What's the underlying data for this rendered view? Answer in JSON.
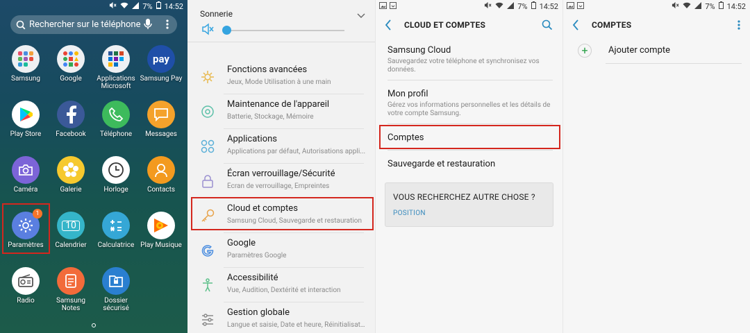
{
  "status_bar": {
    "battery": "7%",
    "time": "14:52"
  },
  "panel1": {
    "search_placeholder": "Rechercher sur le téléphone",
    "apps": [
      {
        "label": "Samsung"
      },
      {
        "label": "Google"
      },
      {
        "label": "Applications Microsoft"
      },
      {
        "label": "Samsung Pay",
        "icon_text": "pay"
      },
      {
        "label": "Play Store"
      },
      {
        "label": "Facebook"
      },
      {
        "label": "Téléphone"
      },
      {
        "label": "Messages"
      },
      {
        "label": "Caméra"
      },
      {
        "label": "Galerie"
      },
      {
        "label": "Horloge"
      },
      {
        "label": "Contacts"
      },
      {
        "label": "Paramètres",
        "badge": "1"
      },
      {
        "label": "Calendrier",
        "icon_text": "10"
      },
      {
        "label": "Calculatrice"
      },
      {
        "label": "Play Musique"
      },
      {
        "label": "Radio"
      },
      {
        "label": "Samsung Notes"
      },
      {
        "label": "Dossier sécurisé"
      }
    ]
  },
  "panel2": {
    "sound_label": "Sonnerie",
    "items": [
      {
        "title": "Fonctions avancées",
        "subtitle": "Jeux, Mode Utilisation à une main"
      },
      {
        "title": "Maintenance de l'appareil",
        "subtitle": "Batterie, Stockage, Mémoire"
      },
      {
        "title": "Applications",
        "subtitle": "Applications par défaut, Autorisations appli..."
      },
      {
        "title": "Écran verrouillage/Sécurité",
        "subtitle": "Écran de verrouillage, Empreintes"
      },
      {
        "title": "Cloud et comptes",
        "subtitle": "Samsung Cloud, Sauvegarde et restauration"
      },
      {
        "title": "Google",
        "subtitle": "Paramètres Google"
      },
      {
        "title": "Accessibilité",
        "subtitle": "Vue, Audition, Dextérité et interaction"
      },
      {
        "title": "Gestion globale",
        "subtitle": "Langue et saisie, Date et heure, Réinitialisati..."
      }
    ]
  },
  "panel3": {
    "title": "CLOUD ET COMPTES",
    "items": [
      {
        "title": "Samsung Cloud",
        "subtitle": "Sauvegardez votre téléphone et synchronisez vos données."
      },
      {
        "title": "Mon profil",
        "subtitle": "Gérez vos informations personnelles et les détails de votre compte Samsung."
      },
      {
        "title": "Comptes"
      },
      {
        "title": "Sauvegarde et restauration"
      }
    ],
    "suggest_title": "VOUS RECHERCHEZ AUTRE CHOSE ?",
    "suggest_link": "POSITION"
  },
  "panel4": {
    "title": "COMPTES",
    "add_account": "Ajouter compte"
  }
}
